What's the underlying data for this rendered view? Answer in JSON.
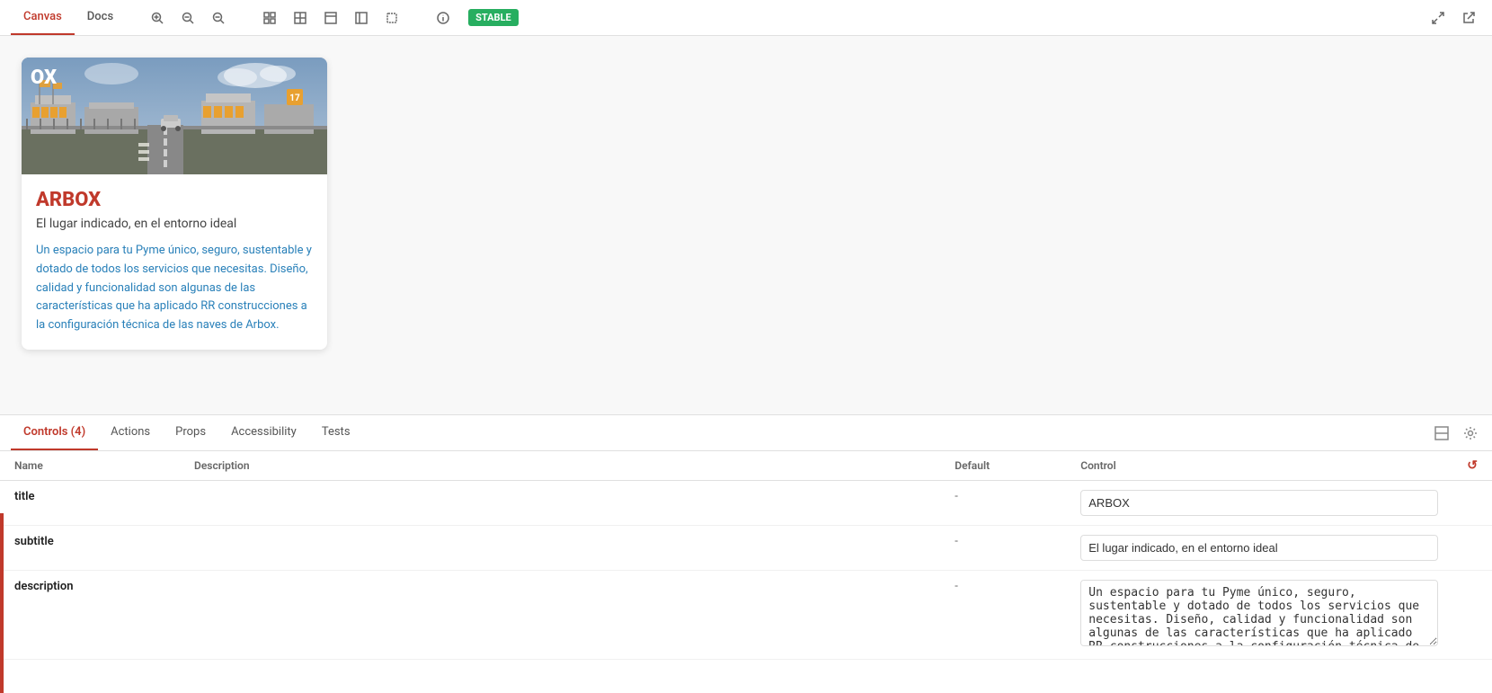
{
  "toolbar": {
    "tabs": [
      {
        "id": "canvas",
        "label": "Canvas",
        "active": true
      },
      {
        "id": "docs",
        "label": "Docs",
        "active": false
      }
    ],
    "badge": "STABLE",
    "icons": [
      {
        "id": "zoom-in",
        "symbol": "🔍",
        "title": "Zoom in"
      },
      {
        "id": "zoom-out",
        "symbol": "🔎",
        "title": "Zoom out"
      },
      {
        "id": "reset-zoom",
        "symbol": "⌕",
        "title": "Reset zoom"
      },
      {
        "id": "grid1",
        "symbol": "▦",
        "title": "Grid"
      },
      {
        "id": "grid2",
        "symbol": "⊞",
        "title": "Grid 2"
      },
      {
        "id": "layout1",
        "symbol": "⊡",
        "title": "Layout"
      },
      {
        "id": "layout2",
        "symbol": "⊟",
        "title": "Layout 2"
      },
      {
        "id": "frame",
        "symbol": "⬚",
        "title": "Frame"
      },
      {
        "id": "info",
        "symbol": "ℹ",
        "title": "Info"
      }
    ],
    "right_icons": [
      {
        "id": "expand",
        "symbol": "⤢",
        "title": "Expand"
      },
      {
        "id": "open",
        "symbol": "↗",
        "title": "Open"
      }
    ]
  },
  "card": {
    "logo": "OX",
    "title": "ARBOX",
    "subtitle": "El lugar indicado, en el entorno ideal",
    "description": "Un espacio para tu Pyme único, seguro, sustentable y dotado de todos los servicios que necesitas. Diseño, calidad y funcionalidad son algunas de las características que ha aplicado RR construcciones a la configuración técnica de las naves de Arbox."
  },
  "bottom_panel": {
    "tabs": [
      {
        "id": "controls",
        "label": "Controls (4)",
        "active": true
      },
      {
        "id": "actions",
        "label": "Actions",
        "active": false
      },
      {
        "id": "props",
        "label": "Props",
        "active": false
      },
      {
        "id": "accessibility",
        "label": "Accessibility",
        "active": false
      },
      {
        "id": "tests",
        "label": "Tests",
        "active": false
      }
    ],
    "table": {
      "headers": [
        "Name",
        "Description",
        "Default",
        "Control"
      ],
      "reset_icon": "↺",
      "rows": [
        {
          "id": "title-row",
          "name": "title",
          "description": "",
          "default": "-",
          "control_value": "ARBOX",
          "control_type": "input"
        },
        {
          "id": "subtitle-row",
          "name": "subtitle",
          "description": "",
          "default": "-",
          "control_value": "El lugar indicado, en el entorno ideal",
          "control_type": "input"
        },
        {
          "id": "description-row",
          "name": "description",
          "description": "",
          "default": "-",
          "control_value": "Un espacio para tu Pyme único, seguro, sustentable y dotado de todos los servicios que necesitas. Diseño, calidad y funcionalidad son algunas de las características que ha aplicado RR construcciones a la configuración técnica de las naves de Arbox.",
          "control_type": "textarea"
        }
      ]
    }
  }
}
